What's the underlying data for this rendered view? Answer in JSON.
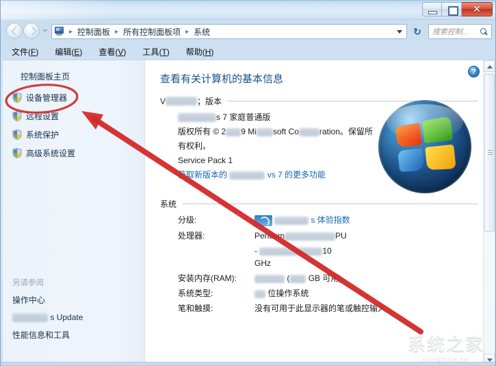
{
  "window": {
    "buttons": {
      "minimize": "–",
      "maximize": "□",
      "close": "✕"
    }
  },
  "navbar": {
    "breadcrumb": [
      "控制面板",
      "所有控制面板项",
      "系统"
    ],
    "separator": "▸",
    "refresh_glyph": "↻",
    "search_placeholder": "搜索控制..."
  },
  "menubar": {
    "items": [
      {
        "text": "文件",
        "accel": "F"
      },
      {
        "text": "编辑",
        "accel": "E"
      },
      {
        "text": "查看",
        "accel": "V"
      },
      {
        "text": "工具",
        "accel": "T"
      },
      {
        "text": "帮助",
        "accel": "H"
      }
    ]
  },
  "sidebar": {
    "home": "控制面板主页",
    "links": [
      "设备管理器",
      "远程设置",
      "系统保护",
      "高级系统设置"
    ],
    "see_also_title": "另请参阅",
    "see_also": [
      "操作中心",
      "s Update",
      "性能信息和工具"
    ]
  },
  "content": {
    "help_glyph": "?",
    "page_title": "查看有关计算机的基本信息",
    "windows_section": {
      "heading_prefix": "V",
      "heading_suffix": "；版本",
      "edition_suffix": "s 7 家庭普通版",
      "copyright_a": "版权所有 © 2",
      "copyright_b": "9 Mi",
      "copyright_c": "soft Co",
      "copyright_d": "ration。保留所",
      "copyright_e": "有权利。",
      "service_pack": "Service Pack 1",
      "upgrade_link_a": "获取新版本的",
      "upgrade_link_b": "vs 7 的更多功能"
    },
    "system_section": {
      "heading": "系统",
      "rows": [
        {
          "key": "分级:",
          "value": "s 体验指数"
        },
        {
          "key": "处理器:",
          "value": "Pentium"
        },
        {
          "key": "安装内存(RAM):",
          "value": "GB 可用)"
        },
        {
          "key": "系统类型:",
          "value": "位操作系统"
        },
        {
          "key": "笔和触摸:",
          "value": "没有可用于此显示器的笔或触控输入"
        }
      ],
      "cpu_suffix": "PU",
      "cpu_speed": "10",
      "cpu_unit": "GHz",
      "ram_paren_open": "("
    }
  },
  "watermark": {
    "text": "系统之家",
    "sub": "xitongzhijia.net"
  },
  "annotations": {
    "circle_target": "设备管理器",
    "color": "#d42a2a"
  }
}
